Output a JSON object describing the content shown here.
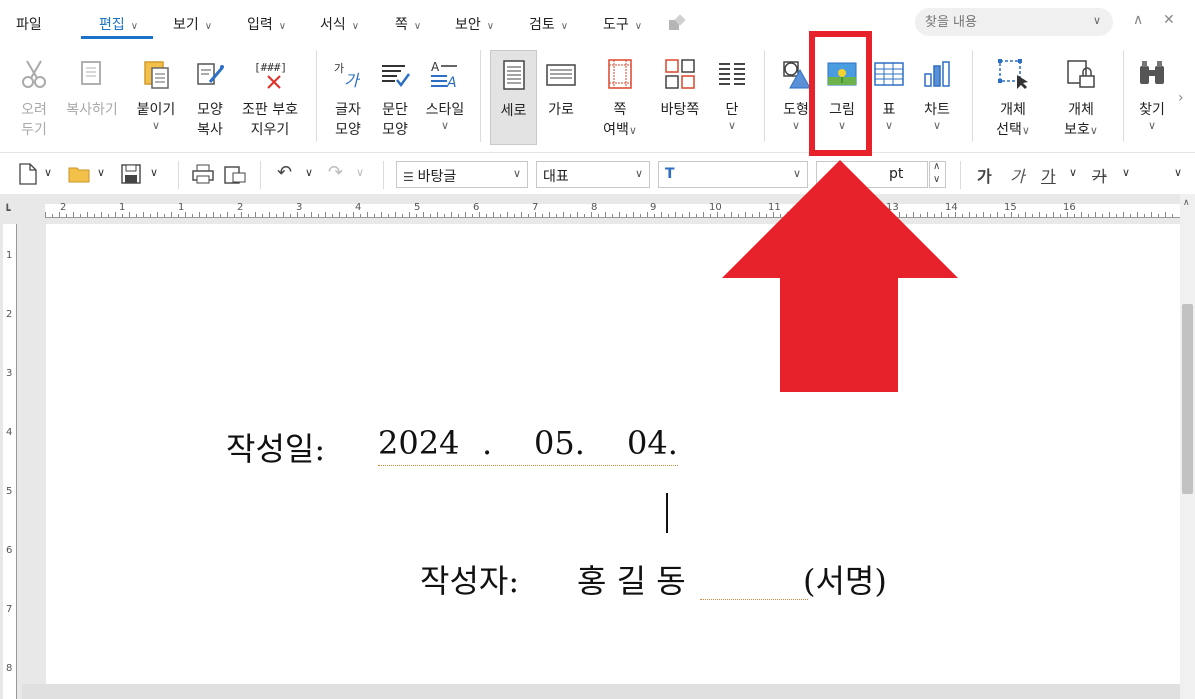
{
  "menubar": {
    "items": [
      {
        "label": "파일",
        "chev": false
      },
      {
        "label": "편집",
        "chev": true,
        "active": true
      },
      {
        "label": "보기",
        "chev": true
      },
      {
        "label": "입력",
        "chev": true
      },
      {
        "label": "서식",
        "chev": true
      },
      {
        "label": "쪽",
        "chev": true
      },
      {
        "label": "보안",
        "chev": true
      },
      {
        "label": "검토",
        "chev": true
      },
      {
        "label": "도구",
        "chev": true
      }
    ],
    "search_placeholder": "찾을 내용"
  },
  "ribbon": {
    "cut": [
      "오려",
      "두기"
    ],
    "copy": "복사하기",
    "paste": "붙이기",
    "shape_copy": [
      "모양",
      "복사"
    ],
    "clear_format": [
      "조판 부호",
      "지우기"
    ],
    "char_shape": [
      "글자",
      "모양"
    ],
    "para_shape": [
      "문단",
      "모양"
    ],
    "style": "스타일",
    "portrait": "세로",
    "landscape": "가로",
    "margins": [
      "쪽",
      "여백"
    ],
    "background": "바탕쪽",
    "columns": "단",
    "shapes": "도형",
    "picture": "그림",
    "table": "표",
    "chart": "차트",
    "object_select": [
      "개체",
      "선택"
    ],
    "object_protect": [
      "개체",
      "보호"
    ],
    "find": "찾기"
  },
  "toolbar": {
    "style_value": "바탕글",
    "lang_value": "대표",
    "font_value": "",
    "size_unit": "pt",
    "bold": "가",
    "italic": "가",
    "underline": "가",
    "strike": "가"
  },
  "ruler": {
    "h_numbers": [
      "2",
      "1",
      "1",
      "2",
      "3",
      "4",
      "5",
      "6",
      "7",
      "8",
      "9",
      "10",
      "11",
      "12",
      "13",
      "14",
      "15",
      "16"
    ],
    "v_numbers": [
      "1",
      "2",
      "3",
      "4",
      "5",
      "6",
      "7",
      "8"
    ]
  },
  "document": {
    "date_label": "작성일:",
    "year": "2024",
    "dot": ".",
    "month": "05.",
    "day": "04.",
    "author_label": "작성자:",
    "author_name": "홍 길 동",
    "signature": "(서명)"
  },
  "annotation": {
    "highlight_color": "#e8222a"
  }
}
